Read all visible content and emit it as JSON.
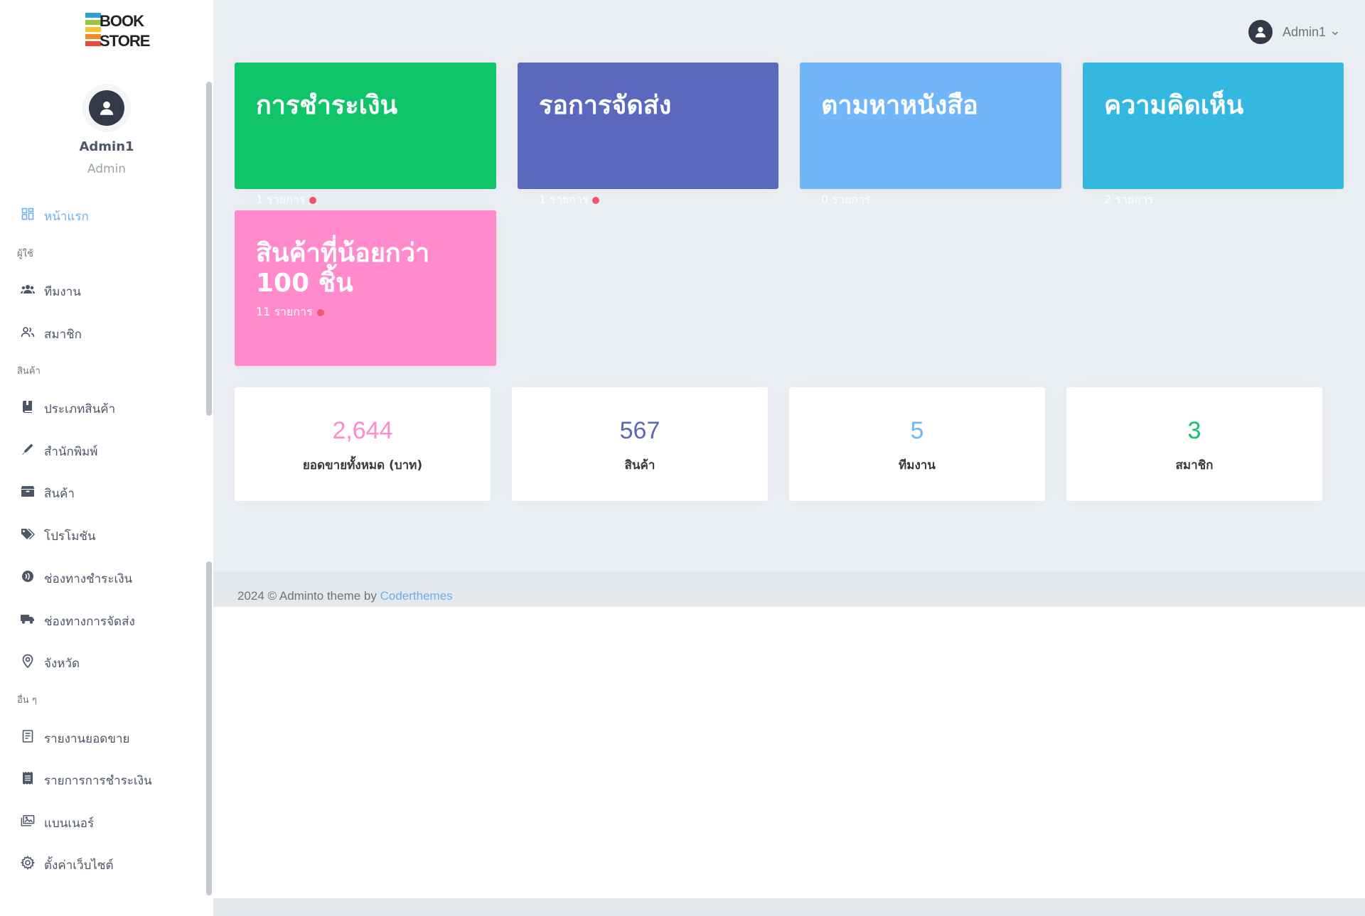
{
  "logo": {
    "line1": "BOOK",
    "line2": "STORE"
  },
  "user": {
    "name": "Admin1",
    "role": "Admin"
  },
  "sidebar": {
    "items": [
      {
        "label": "หน้าแรก",
        "icon": "dashboard-icon",
        "active": true
      },
      {
        "label": "ผู้ใช้",
        "type": "title"
      },
      {
        "label": "ทีมงาน",
        "icon": "team-icon"
      },
      {
        "label": "สมาชิก",
        "icon": "members-icon"
      },
      {
        "label": "สินค้า",
        "type": "title"
      },
      {
        "label": "ประเภทสินค้า",
        "icon": "book-icon"
      },
      {
        "label": "สำนักพิมพ์",
        "icon": "pen-icon"
      },
      {
        "label": "สินค้า",
        "icon": "box-icon"
      },
      {
        "label": "โปรโมชัน",
        "icon": "tags-icon"
      },
      {
        "label": "ช่องทางชำระเงิน",
        "icon": "payment-icon"
      },
      {
        "label": "ช่องทางการจัดส่ง",
        "icon": "truck-icon"
      },
      {
        "label": "จังหวัด",
        "icon": "map-pin-icon"
      },
      {
        "label": "อื่น ๆ",
        "type": "title"
      },
      {
        "label": "รายงานยอดขาย",
        "icon": "report-icon"
      },
      {
        "label": "รายการการชำระเงิน",
        "icon": "receipt-icon"
      },
      {
        "label": "แบนเนอร์",
        "icon": "images-icon"
      },
      {
        "label": "ตั้งค่าเว็บไซต์",
        "icon": "gear-icon"
      }
    ]
  },
  "topbar": {
    "username": "Admin1"
  },
  "cards": [
    {
      "title": "การชำระเงิน",
      "count": "1 รายการ",
      "color": "#10c469",
      "dot": true
    },
    {
      "title": "รอการจัดส่ง",
      "count": "1 รายการ",
      "color": "#5b69bc",
      "dot": true
    },
    {
      "title": "ตามหาหนังสือ",
      "count": "0 รายการ",
      "color": "#71b6f9",
      "dot": false
    },
    {
      "title": "ความคิดเห็น",
      "count": "2 รายการ",
      "color": "#35b8e0",
      "dot": false
    },
    {
      "title": "สินค้าที่น้อยกว่า 100 ชิ้น",
      "count": "11 รายการ",
      "color": "#ff8acc",
      "dot": true
    }
  ],
  "stats": [
    {
      "value": "2,644",
      "label": "ยอดขายทั้งหมด (บาท)",
      "color": "#ff8acc"
    },
    {
      "value": "567",
      "label": "สินค้า",
      "color": "#5b69bc"
    },
    {
      "value": "5",
      "label": "ทีมงาน",
      "color": "#71b6f9"
    },
    {
      "value": "3",
      "label": "สมาชิก",
      "color": "#10c469"
    }
  ],
  "footer": {
    "text": "2024 © Adminto theme by ",
    "link": "Coderthemes"
  }
}
